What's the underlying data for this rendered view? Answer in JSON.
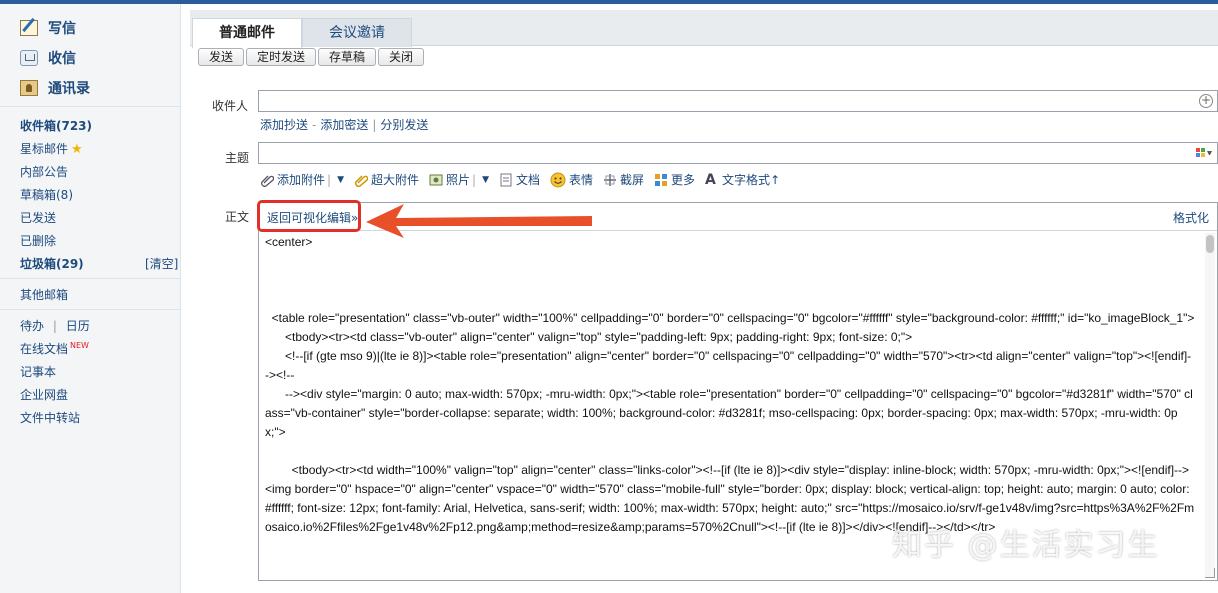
{
  "sidebar": {
    "compose": "写信",
    "receive": "收信",
    "contacts": "通讯录",
    "folders": [
      {
        "label": "收件箱(723)",
        "bold": true
      },
      {
        "label": "星标邮件"
      },
      {
        "label": "内部公告"
      },
      {
        "label": "草稿箱(8)"
      },
      {
        "label": "已发送"
      },
      {
        "label": "已删除"
      },
      {
        "label": "垃圾箱(29)",
        "bold": true
      }
    ],
    "clear_label": "[清空]",
    "other_mailbox": "其他邮箱",
    "todo": "待办",
    "calendar": "日历",
    "online_docs": "在线文档",
    "new_badge": "NEW",
    "notes": "记事本",
    "netdisk": "企业网盘",
    "file_transfer": "文件中转站"
  },
  "tabs": [
    "普通邮件",
    "会议邀请"
  ],
  "toolbar": {
    "send": "发送",
    "schedule": "定时发送",
    "save_draft": "存草稿",
    "close": "关闭"
  },
  "form": {
    "to_label": "收件人",
    "to_value": "",
    "add_cc": "添加抄送",
    "dash": "-",
    "add_bcc": "添加密送",
    "pipe": "|",
    "separate_send": "分别发送",
    "subject_label": "主题",
    "subject_value": "",
    "body_label": "正文"
  },
  "attach_bar": {
    "add_attachment": "添加附件",
    "large_attachment": "超大附件",
    "photo": "照片",
    "document": "文档",
    "emoji": "表情",
    "screenshot": "截屏",
    "more": "更多",
    "text_format": "文字格式",
    "text_format_arrow": "↑"
  },
  "editor": {
    "back_to_visual": "返回可视化编辑»",
    "format": "格式化",
    "source": "<center>\n\n\n\n  <table role=\"presentation\" class=\"vb-outer\" width=\"100%\" cellpadding=\"0\" border=\"0\" cellspacing=\"0\" bgcolor=\"#ffffff\" style=\"background-color: #ffffff;\" id=\"ko_imageBlock_1\">\n      <tbody><tr><td class=\"vb-outer\" align=\"center\" valign=\"top\" style=\"padding-left: 9px; padding-right: 9px; font-size: 0;\">\n      <!--[if (gte mso 9)|(lte ie 8)]><table role=\"presentation\" align=\"center\" border=\"0\" cellspacing=\"0\" cellpadding=\"0\" width=\"570\"><tr><td align=\"center\" valign=\"top\"><![endif]--><!--\n      --><div style=\"margin: 0 auto; max-width: 570px; -mru-width: 0px;\"><table role=\"presentation\" border=\"0\" cellpadding=\"0\" cellspacing=\"0\" bgcolor=\"#d3281f\" width=\"570\" class=\"vb-container\" style=\"border-collapse: separate; width: 100%; background-color: #d3281f; mso-cellspacing: 0px; border-spacing: 0px; max-width: 570px; -mru-width: 0px;\">\n\n        <tbody><tr><td width=\"100%\" valign=\"top\" align=\"center\" class=\"links-color\"><!--[if (lte ie 8)]><div style=\"display: inline-block; width: 570px; -mru-width: 0px;\"><![endif]--><img border=\"0\" hspace=\"0\" align=\"center\" vspace=\"0\" width=\"570\" class=\"mobile-full\" style=\"border: 0px; display: block; vertical-align: top; height: auto; margin: 0 auto; color: #ffffff; font-size: 12px; font-family: Arial, Helvetica, sans-serif; width: 100%; max-width: 570px; height: auto;\" src=\"https://mosaico.io/srv/f-ge1v48v/img?src=https%3A%2F%2Fmosaico.io%2Ffiles%2Fge1v48v%2Fp12.png&amp;method=resize&amp;params=570%2Cnull\"><!--[if (lte ie 8)]></div><![endif]--></td></tr>"
  },
  "watermark": "知乎 @生活实习生",
  "colors": {
    "accent": "#1e4a7d",
    "highlight": "#e0302a",
    "arrow": "#e8502a"
  }
}
